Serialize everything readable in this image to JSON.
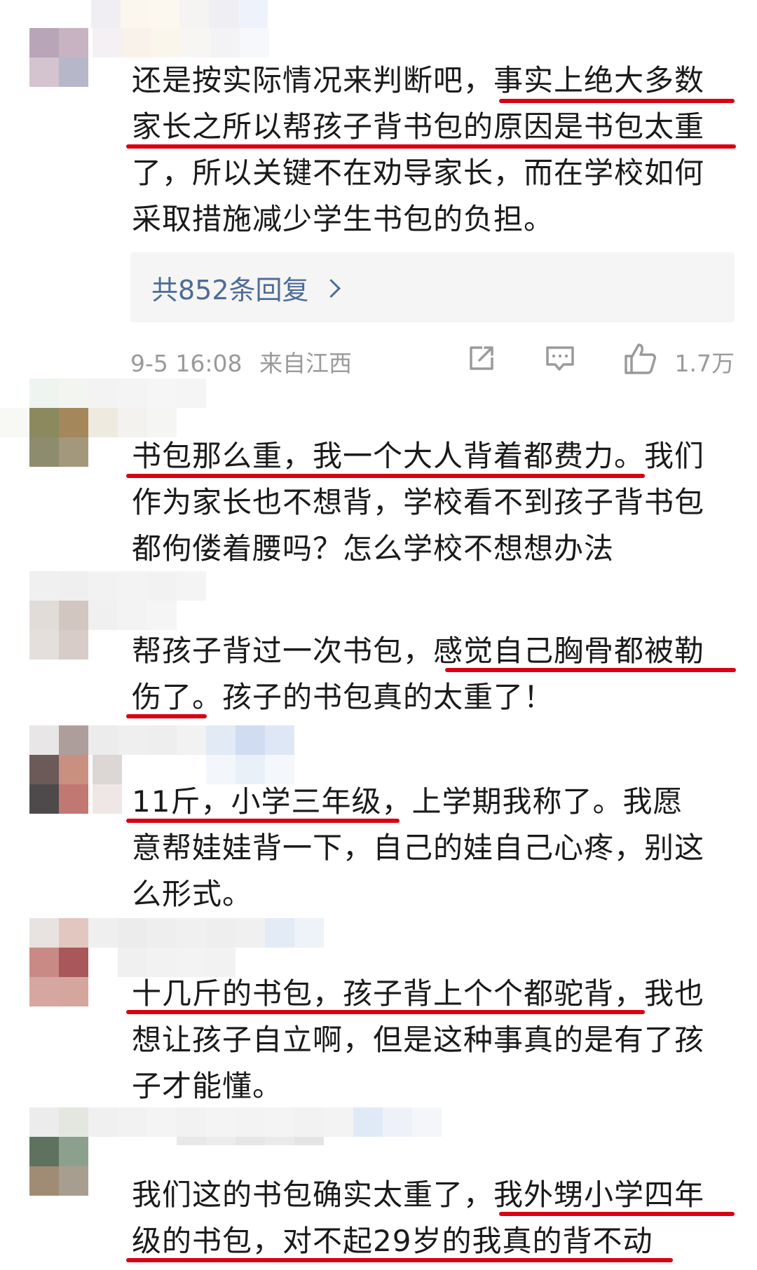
{
  "comments": [
    {
      "lines": [
        "还是按实际情况来判断吧，事实上绝大多数",
        "家长之所以帮孩子背书包的原因是书包太重",
        "了，所以关键不在劝导家长，而在学校如何",
        "采取措施减少学生书包的负担。"
      ],
      "reply_label": "共852条回复",
      "date": "9-5 16:08",
      "location": "来自江西",
      "likes": "1.7万"
    },
    {
      "lines": [
        "书包那么重，我一个大人背着都费力。我们",
        "作为家长也不想背，学校看不到孩子背书包",
        "都佝偻着腰吗？怎么学校不想想办法"
      ]
    },
    {
      "lines": [
        "帮孩子背过一次书包，感觉自己胸骨都被勒",
        "伤了。孩子的书包真的太重了！"
      ]
    },
    {
      "lines": [
        "11斤，小学三年级，上学期我称了。我愿",
        "意帮娃娃背一下，自己的娃自己心疼，别这",
        "么形式。"
      ]
    },
    {
      "lines": [
        "十几斤的书包，孩子背上个个都驼背，我也",
        "想让孩子自立啊，但是这种事真的是有了孩",
        "子才能懂。"
      ]
    },
    {
      "lines": [
        "我们这的书包确实太重了，我外甥小学四年",
        "级的书包，对不起29岁的我真的背不动"
      ]
    }
  ],
  "icons": {
    "share": "share-icon",
    "comment": "comment-icon",
    "like": "thumbs-up-icon"
  },
  "colors": {
    "underline": "#d90012",
    "reply_text": "#4d6c96",
    "meta_text": "#9a9a9a"
  }
}
